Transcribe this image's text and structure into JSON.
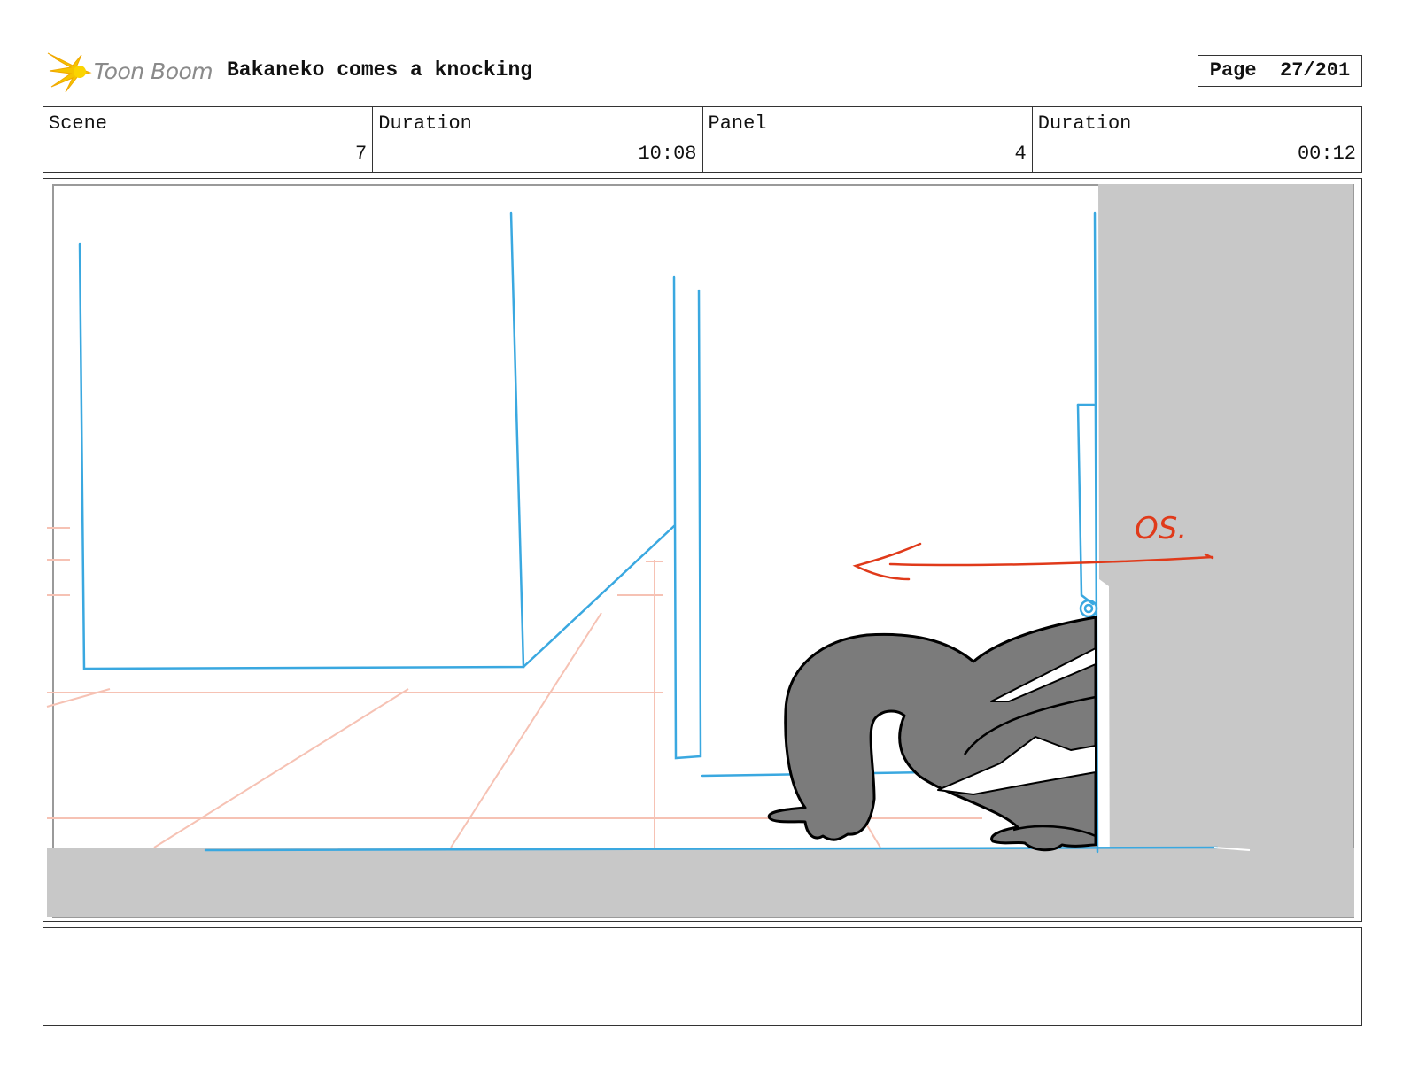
{
  "header": {
    "logo_text": "Toon Boom",
    "title": "Bakaneko comes a knocking",
    "page_label": "Page",
    "page_number": "27/201"
  },
  "info": {
    "scene_label": "Scene",
    "scene_value": "7",
    "scene_duration_label": "Duration",
    "scene_duration_value": "10:08",
    "panel_label": "Panel",
    "panel_value": "4",
    "panel_duration_label": "Duration",
    "panel_duration_value": "00:12"
  },
  "drawing": {
    "annotation": "OS.",
    "colors": {
      "layout_blue": "#3aa8e0",
      "guide_pink": "#f6c2b4",
      "arrow_red": "#e03a1a",
      "character_gray": "#7b7b7b",
      "wall_gray": "#c8c8c8"
    }
  },
  "notes": {
    "text": ""
  }
}
